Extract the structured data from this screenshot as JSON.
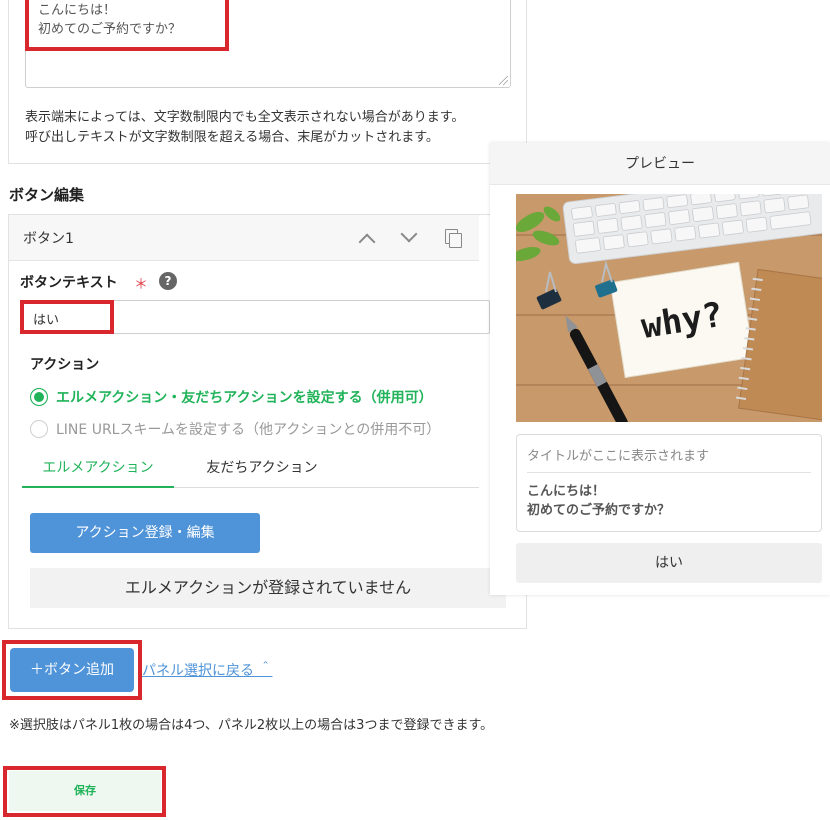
{
  "message": {
    "text": "こんにちは！\n初めてのご予約ですか？",
    "note_line1": "表示端末によっては、文字数制限内でも全文表示されない場合があります。",
    "note_line2": "呼び出しテキストが文字数制限を超える場合、末尾がカットされます。"
  },
  "button_edit": {
    "section_title": "ボタン編集",
    "card_label": "ボタン1",
    "icons": [
      "chevron-up-icon",
      "chevron-down-icon",
      "copy-icon"
    ],
    "field_label": "ボタンテキスト",
    "required_mark": "＊",
    "help_glyph": "?",
    "input_value": "はい",
    "action_title": "アクション",
    "radio_options": [
      {
        "label": "エルメアクション・友だちアクションを設定する（併用可）",
        "selected": true
      },
      {
        "label": "LINE URLスキームを設定する（他アクションとの併用不可）",
        "selected": false
      }
    ],
    "tabs": [
      {
        "label": "エルメアクション",
        "active": true
      },
      {
        "label": "友だちアクション",
        "active": false
      }
    ],
    "register_button": "アクション登録・編集",
    "empty_message": "エルメアクションが登録されていません"
  },
  "footer": {
    "add_button": "＋ボタン追加",
    "back_link": "パネル選択に戻る ＾",
    "choice_note": "※選択肢はパネル1枚の場合は4つ、パネル2枚以上の場合は3つまで登録できます。",
    "save_button": "保存"
  },
  "preview": {
    "header": "プレビュー",
    "image_text": "why?",
    "title_placeholder": "タイトルがここに表示されます",
    "body_text": "こんにちは！\n初めてのご予約ですか？",
    "button_label": "はい"
  },
  "colors": {
    "accent_green": "#21b35a",
    "button_blue": "#4f93d9",
    "highlight_red": "#d9272e"
  }
}
